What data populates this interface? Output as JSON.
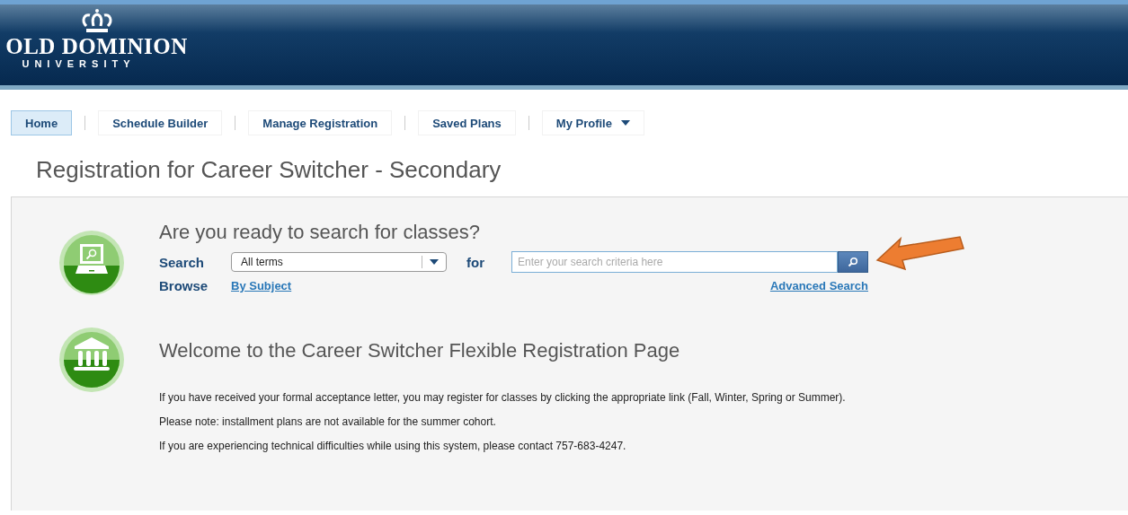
{
  "header": {
    "logo_name": "OLD DOMINION",
    "logo_sub": "UNIVERSITY"
  },
  "tabs": [
    {
      "label": "Home",
      "selected": true,
      "dropdown": false
    },
    {
      "label": "Schedule Builder",
      "selected": false,
      "dropdown": false
    },
    {
      "label": "Manage Registration",
      "selected": false,
      "dropdown": false
    },
    {
      "label": "Saved Plans",
      "selected": false,
      "dropdown": false
    },
    {
      "label": "My Profile",
      "selected": false,
      "dropdown": true
    }
  ],
  "page_title": "Registration for Career Switcher - Secondary",
  "search_section": {
    "heading": "Are you ready to search for classes?",
    "search_label": "Search",
    "term_select": "All terms",
    "for_label": "for",
    "placeholder": "Enter your search criteria here",
    "browse_label": "Browse",
    "browse_link": "By Subject",
    "advanced_link": "Advanced Search"
  },
  "welcome_section": {
    "heading": "Welcome to the Career Switcher Flexible Registration Page",
    "paragraphs": [
      "If you have received your formal acceptance letter, you may register for classes by clicking the appropriate link (Fall, Winter, Spring or Summer).",
      "Please note: installment plans are not available for the summer cohort.",
      "If you are experiencing technical difficulties while using this system, please contact 757-683-4247."
    ]
  }
}
